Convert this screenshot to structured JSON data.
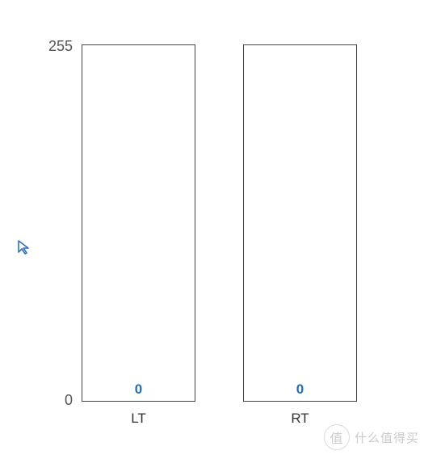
{
  "chart_data": {
    "type": "bar",
    "categories": [
      "LT",
      "RT"
    ],
    "values": [
      0,
      0
    ],
    "title": "",
    "xlabel": "",
    "ylabel": "",
    "ylim": [
      0,
      255
    ]
  },
  "axis": {
    "y_max_label": "255",
    "y_min_label": "0"
  },
  "bars": {
    "left": {
      "label": "LT",
      "value": "0"
    },
    "right": {
      "label": "RT",
      "value": "0"
    }
  },
  "watermark": {
    "icon_text": "值",
    "text": "什么值得买"
  }
}
